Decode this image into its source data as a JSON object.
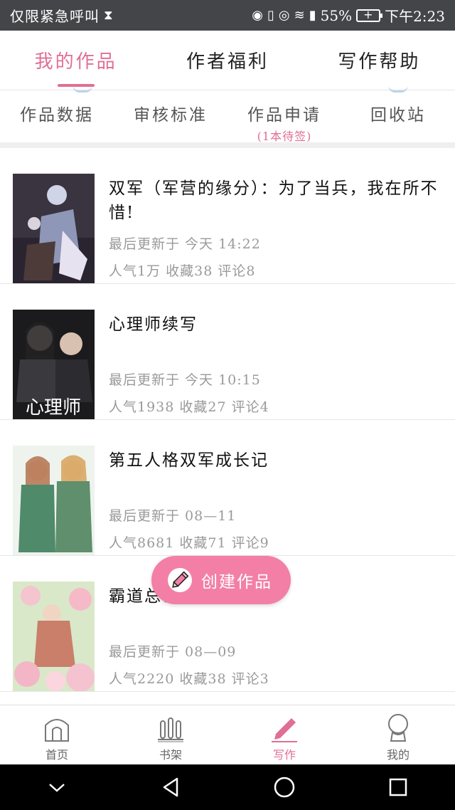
{
  "status_bar": {
    "left_text": "仅限紧急呼叫",
    "battery": "55%",
    "time": "下午2:23"
  },
  "top_tabs": [
    {
      "label": "我的作品",
      "active": true
    },
    {
      "label": "作者福利",
      "active": false
    },
    {
      "label": "写作帮助",
      "active": false
    }
  ],
  "sub_nav": [
    {
      "label": "作品数据",
      "sub": ""
    },
    {
      "label": "审核标准",
      "sub": ""
    },
    {
      "label": "作品申请",
      "sub": "(1本待签)"
    },
    {
      "label": "回收站",
      "sub": ""
    }
  ],
  "works": [
    {
      "title": "双军（军营的缘分）：为了当兵，我在所不惜!",
      "updated": "最后更新于 今天 14:22",
      "stats": "人气1万 收藏38 评论8"
    },
    {
      "title": "心理师续写",
      "updated": "最后更新于 今天 10:15",
      "stats": "人气1938 收藏27 评论4",
      "cover_text": "心理师"
    },
    {
      "title": "第五人格双军成长记",
      "updated": "最后更新于 08—11",
      "stats": "人气8681 收藏71 评论9"
    },
    {
      "title": "霸道总裁爱上我的你",
      "updated": "最后更新于 08—09",
      "stats": "人气2220 收藏38 评论3"
    }
  ],
  "fab": {
    "label": "创建作品"
  },
  "bottom_nav": [
    {
      "label": "首页",
      "icon": "home-icon",
      "active": false
    },
    {
      "label": "书架",
      "icon": "bookshelf-icon",
      "active": false
    },
    {
      "label": "写作",
      "icon": "pen-icon",
      "active": true
    },
    {
      "label": "我的",
      "icon": "profile-icon",
      "active": false
    }
  ],
  "colors": {
    "accent": "#e06f94",
    "fab": "#f37fa6",
    "status_bar": "#444548"
  }
}
